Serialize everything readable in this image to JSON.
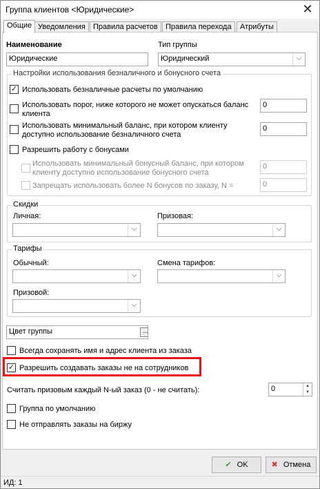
{
  "window": {
    "title": "Группа клиентов <Юридические>"
  },
  "tabs": [
    "Общие",
    "Уведомления",
    "Правила расчетов",
    "Правила перехода",
    "Атрибуты"
  ],
  "name": {
    "label": "Наименование",
    "value": "Юридические"
  },
  "group_type": {
    "label": "Тип группы",
    "value": "Юридический"
  },
  "cashless": {
    "legend": "Настройки использования безналичного и бонусного счета",
    "use_default": "Использовать безналичные расчеты по умолчанию",
    "threshold": "Использовать порог, ниже которого не может опускаться баланс клиента",
    "threshold_value": "0",
    "min_balance": "Использовать минимальный баланс, при котором клиенту доступно использование безналичного счета",
    "min_balance_value": "0",
    "allow_bonus": "Разрешить работу с бонусами",
    "min_bonus_balance": "Использовать минимальный бонусный баланс, при котором клиенту доступно использование бонусного счета",
    "min_bonus_balance_value": "0",
    "forbid_more_bonus": "Запрещать использовать более N бонусов по заказу, N =",
    "forbid_more_bonus_value": "0"
  },
  "discounts": {
    "legend": "Скидки",
    "personal": "Личная:",
    "prize": "Призовая:"
  },
  "tariffs": {
    "legend": "Тарифы",
    "regular": "Обычный:",
    "change": "Смена тарифов:",
    "prize": "Призовой:"
  },
  "group_color": {
    "label": "Цвет группы",
    "button": "..."
  },
  "options": {
    "always_save": "Всегда сохранять имя и адрес клиента из заказа",
    "allow_not_employees": "Разрешить создавать заказы не на сотрудников",
    "count_prize_label": "Считать призовым каждый N-ый заказ (0 - не считать):",
    "count_prize_value": "0",
    "default_group": "Группа по умолчанию",
    "no_exchange": "Не отправлять заказы на биржу"
  },
  "buttons": {
    "ok": "OK",
    "cancel": "Отмена"
  },
  "status": {
    "id": "ИД: 1"
  }
}
